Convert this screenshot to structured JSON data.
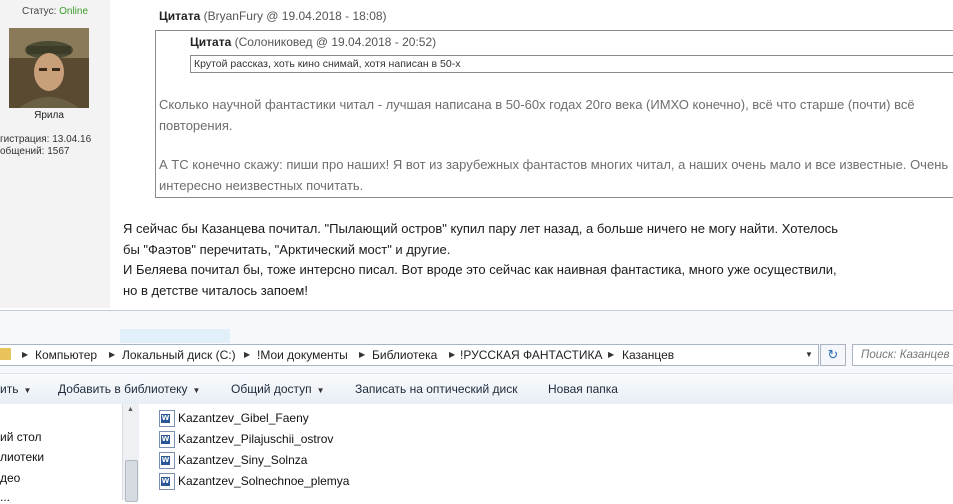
{
  "forum": {
    "status_label": "Статус:",
    "status_value": "Online",
    "username": "Ярила",
    "registration": "гистрация: 13.04.16",
    "messages": "общений: 1567",
    "quote_outer": {
      "label": "Цитата",
      "author": "(BryanFury @ 19.04.2018 - 18:08)"
    },
    "quote_inner": {
      "label": "Цитата",
      "author": "(Солониковед @ 19.04.2018 - 20:52)",
      "text": "Крутой рассказ, хоть кино снимай, хотя написан в 50-х"
    },
    "quote_para1": "Сколько научной фантастики читал - лучшая написана в 50-60х годах 20го века (ИМХО конечно), всё что старше (почти) всё повторения.",
    "quote_para2": "А ТС конечно скажу: пиши про наших! Я вот из зарубежных фантастов многих читал, а наших очень мало и все известные. Очень интересно неизвестных почитать.",
    "reply_line1": "Я сейчас бы Казанцева почитал. \"Пылающий остров\" купил пару лет назад, а больше ничего не могу найти. Хотелось",
    "reply_line2": "бы \"Фаэтов\" перечитать, \"Арктический мост\" и другие.",
    "reply_line3": "И Беляева почитал бы, тоже интерсно писал. Вот вроде это сейчас как наивная фантастика, много уже осуществили,",
    "reply_line4": "но в детстве читалось запоем!"
  },
  "explorer": {
    "breadcrumbs": [
      "Компьютер",
      "Локальный диск (C:)",
      "!Мои документы",
      "Библиотека",
      "!РУССКАЯ ФАНТАСТИКА",
      "Казанцев"
    ],
    "search_placeholder": "Поиск: Казанцев",
    "toolbar": {
      "organize": "ить",
      "add_library": "Добавить в библиотеку",
      "share": "Общий доступ",
      "burn": "Записать на оптический диск",
      "new_folder": "Новая папка"
    },
    "nav_items": [
      "ий стол",
      "лиотеки",
      "део",
      "..."
    ],
    "files": [
      "Kazantzev_Gibel_Faeny",
      "Kazantzev_Pilajuschii_ostrov",
      "Kazantzev_Siny_Solnza",
      "Kazantzev_Solnechnoe_plemya"
    ]
  },
  "icons": [
    "folder-icon",
    "word-doc-icon",
    "refresh-icon",
    "chevron-down-icon",
    "breadcrumb-arrow-icon"
  ],
  "colors": {
    "online": "#3a9a2a",
    "quote_text": "#6e6e6e",
    "explorer_bg": "#f6f8fb",
    "word_blue": "#2b5797"
  }
}
